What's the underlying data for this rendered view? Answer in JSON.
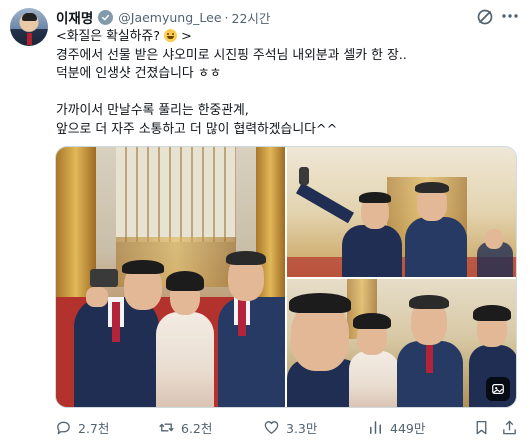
{
  "post": {
    "author_name": "이재명",
    "handle": "@Jaemyung_Lee",
    "separator": "·",
    "time": "22시간",
    "text_lines": [
      "<화질은 확실하쥬? ",
      " >",
      "경주에서 선물 받은 샤오미로 시진핑 주석님 내외분과 셀카 한 장..",
      "덕분에 인생샷 건졌습니다 ㅎㅎ",
      "",
      "가까이서 만날수록 풀리는 한중관계,",
      "앞으로 더 자주 소통하고 더 많이 협력하겠습니다^^"
    ],
    "emoji_name": "grinning-face-emoji"
  },
  "actions": {
    "replies": "2.7천",
    "reposts": "6.2천",
    "likes": "3.3만",
    "views": "449만"
  },
  "icons": {
    "verified": "verified-badge-icon",
    "grok": "grok-icon",
    "more": "more-icon",
    "reply": "reply-icon",
    "repost": "repost-icon",
    "like": "like-icon",
    "views": "views-icon",
    "bookmark": "bookmark-icon",
    "share": "share-icon",
    "alt_badge": "image-badge-icon"
  },
  "colors": {
    "text": "#0f1419",
    "muted": "#536471",
    "verified_badge": "#829aab",
    "border": "#cfd9de"
  }
}
